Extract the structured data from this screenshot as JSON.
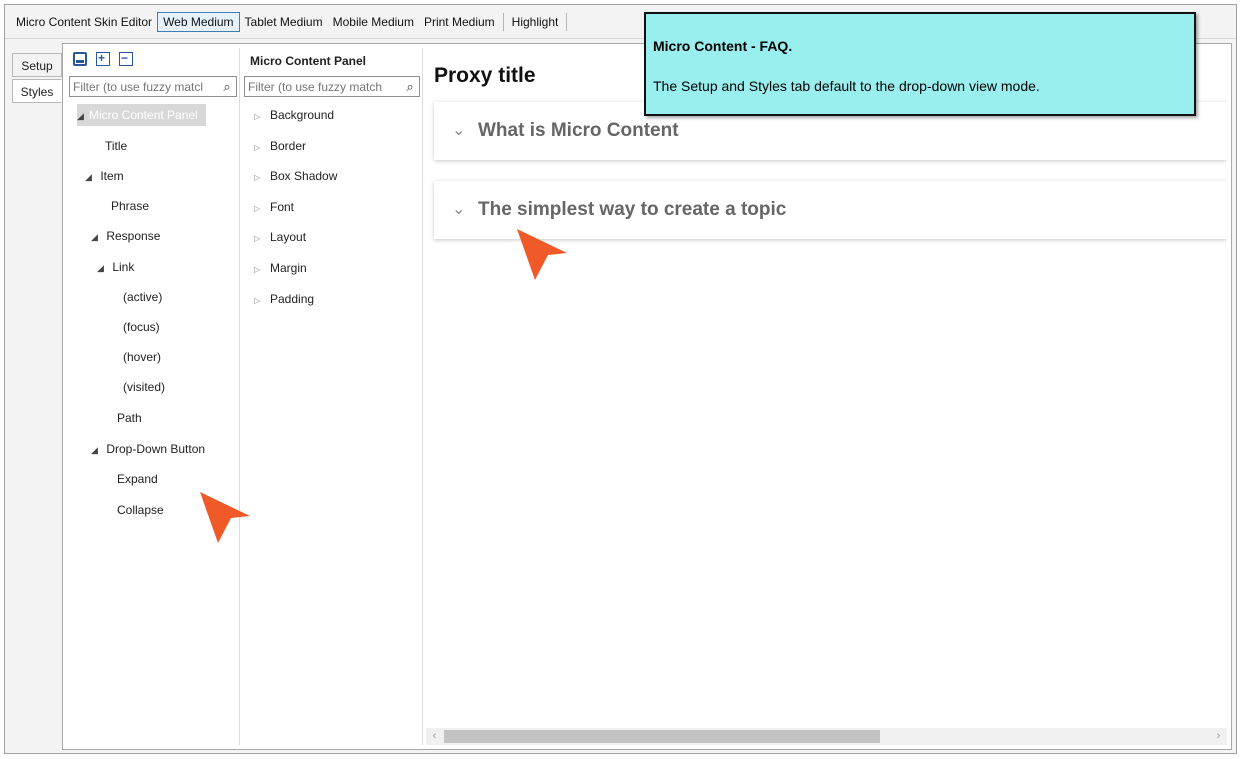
{
  "toolbar": {
    "items": [
      "Micro Content Skin Editor",
      "Web Medium",
      "Tablet Medium",
      "Mobile Medium",
      "Print Medium",
      "Highlight"
    ]
  },
  "side_tabs": {
    "setup": "Setup",
    "styles": "Styles"
  },
  "element_column": {
    "filter_placeholder": "Filter (to use fuzzy matcl",
    "tree": [
      {
        "label": "Micro Content Panel",
        "expanded": true,
        "selected": true
      },
      {
        "label": "Title"
      },
      {
        "label": "Item",
        "expanded": true
      },
      {
        "label": "Phrase"
      },
      {
        "label": "Response",
        "expanded": true
      },
      {
        "label": "Link",
        "expanded": true
      },
      {
        "label": "(active)"
      },
      {
        "label": "(focus)"
      },
      {
        "label": "(hover)"
      },
      {
        "label": "(visited)"
      },
      {
        "label": "Path"
      },
      {
        "label": "Drop-Down Button",
        "expanded": true
      },
      {
        "label": "Expand"
      },
      {
        "label": "Collapse"
      }
    ]
  },
  "property_column": {
    "title": "Micro Content Panel",
    "filter_placeholder": "Filter (to use fuzzy match",
    "groups": [
      "Background",
      "Border",
      "Box Shadow",
      "Font",
      "Layout",
      "Margin",
      "Padding"
    ]
  },
  "preview": {
    "title": "Proxy title",
    "questions": [
      "What is Micro Content",
      "The simplest way to create a topic"
    ]
  },
  "callout": {
    "title": "Micro Content - FAQ.",
    "body": "The Setup and Styles tab default to the drop-down view mode.",
    "color": "#99eeee"
  },
  "colors": {
    "pointer": "#f05a28",
    "selection": "#d8d8d8",
    "accent": "#2b579a"
  }
}
